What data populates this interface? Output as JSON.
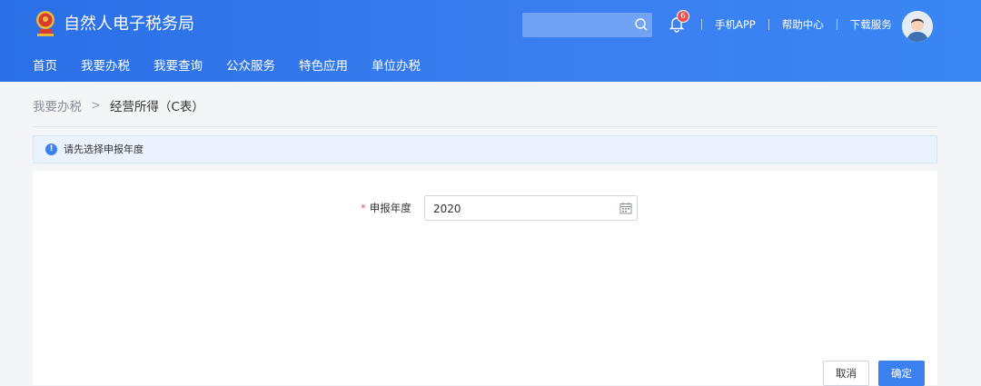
{
  "header": {
    "site_title": "自然人电子税务局",
    "notification_count": "6",
    "links": [
      "手机APP",
      "帮助中心",
      "下载服务"
    ]
  },
  "nav": {
    "items": [
      "首页",
      "我要办税",
      "我要查询",
      "公众服务",
      "特色应用",
      "单位办税"
    ]
  },
  "breadcrumb": {
    "parent": "我要办税",
    "separator": ">",
    "current": "经营所得（C表）"
  },
  "alert": {
    "icon": "info-icon",
    "icon_glyph": "!",
    "text": "请先选择申报年度"
  },
  "form": {
    "required_mark": "*",
    "year_label": "申报年度",
    "year_value": "2020"
  },
  "actions": {
    "cancel_label": "取消",
    "confirm_label": "确定"
  },
  "colors": {
    "header_blue": "#2a6fe6",
    "accent": "#3b82f0",
    "badge_red": "#f04b4b",
    "alert_bg": "#eaf3fd"
  }
}
